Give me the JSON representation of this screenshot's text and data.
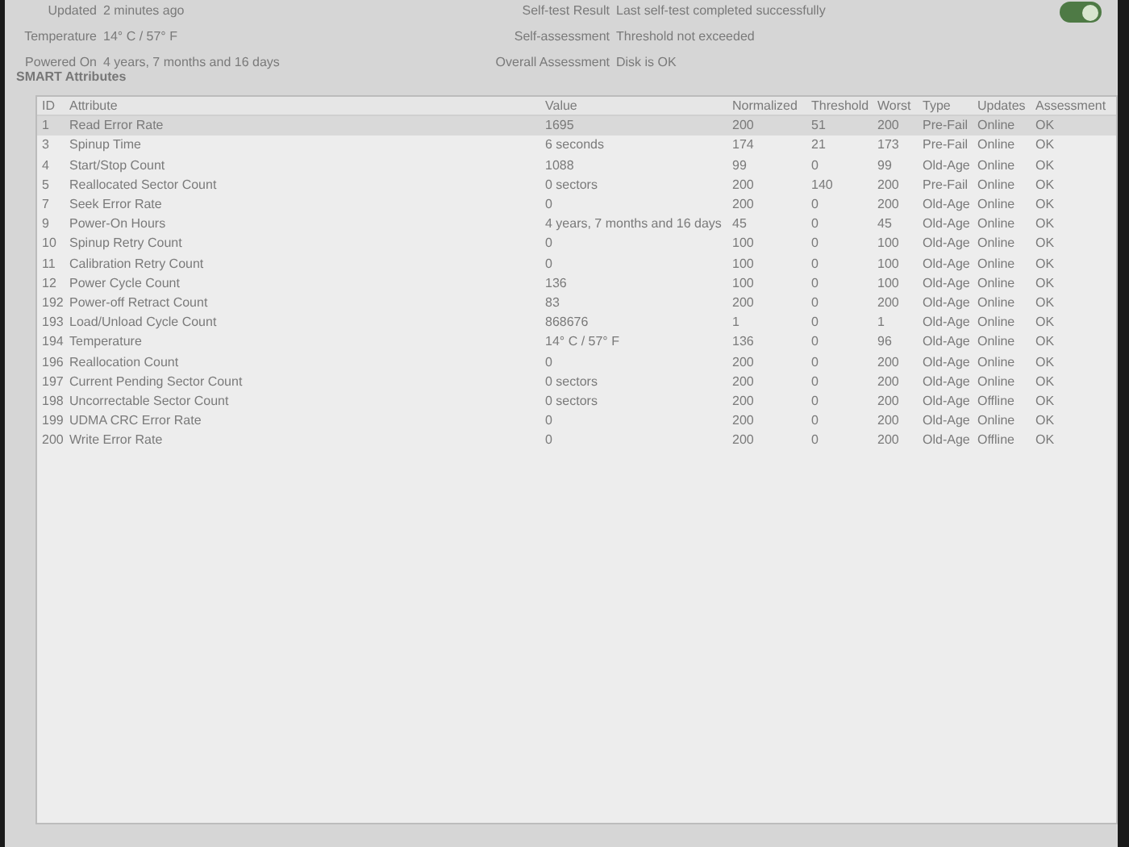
{
  "info_left": [
    {
      "label": "Updated",
      "value": "2 minutes ago"
    },
    {
      "label": "Temperature",
      "value": "14° C / 57° F"
    },
    {
      "label": "Powered On",
      "value": "4 years, 7 months and 16 days"
    }
  ],
  "info_right": [
    {
      "label": "Self-test Result",
      "value": "Last self-test completed successfully"
    },
    {
      "label": "Self-assessment",
      "value": "Threshold not exceeded"
    },
    {
      "label": "Overall Assessment",
      "value": "Disk is OK"
    }
  ],
  "smart_toggle": {
    "on": true
  },
  "section_title": "SMART Attributes",
  "table": {
    "columns": [
      "ID",
      "Attribute",
      "Value",
      "Normalized",
      "Threshold",
      "Worst",
      "Type",
      "Updates",
      "Assessment"
    ],
    "rows": [
      {
        "cells": [
          "1",
          "Read Error Rate",
          "1695",
          "200",
          "51",
          "200",
          "Pre-Fail",
          "Online",
          "OK"
        ],
        "selected": true
      },
      {
        "cells": [
          "3",
          "Spinup Time",
          "6 seconds",
          "174",
          "21",
          "173",
          "Pre-Fail",
          "Online",
          "OK"
        ],
        "selected": false
      },
      {
        "cells": [
          "4",
          "Start/Stop Count",
          "1088",
          "99",
          "0",
          "99",
          "Old-Age",
          "Online",
          "OK"
        ],
        "selected": false
      },
      {
        "cells": [
          "5",
          "Reallocated Sector Count",
          "0 sectors",
          "200",
          "140",
          "200",
          "Pre-Fail",
          "Online",
          "OK"
        ],
        "selected": false
      },
      {
        "cells": [
          "7",
          "Seek Error Rate",
          "0",
          "200",
          "0",
          "200",
          "Old-Age",
          "Online",
          "OK"
        ],
        "selected": false
      },
      {
        "cells": [
          "9",
          "Power-On Hours",
          "4 years, 7 months and 16 days",
          "45",
          "0",
          "45",
          "Old-Age",
          "Online",
          "OK"
        ],
        "selected": false
      },
      {
        "cells": [
          "10",
          "Spinup Retry Count",
          "0",
          "100",
          "0",
          "100",
          "Old-Age",
          "Online",
          "OK"
        ],
        "selected": false
      },
      {
        "cells": [
          "11",
          "Calibration Retry Count",
          "0",
          "100",
          "0",
          "100",
          "Old-Age",
          "Online",
          "OK"
        ],
        "selected": false
      },
      {
        "cells": [
          "12",
          "Power Cycle Count",
          "136",
          "100",
          "0",
          "100",
          "Old-Age",
          "Online",
          "OK"
        ],
        "selected": false
      },
      {
        "cells": [
          "192",
          "Power-off Retract Count",
          "83",
          "200",
          "0",
          "200",
          "Old-Age",
          "Online",
          "OK"
        ],
        "selected": false
      },
      {
        "cells": [
          "193",
          "Load/Unload Cycle Count",
          "868676",
          "1",
          "0",
          "1",
          "Old-Age",
          "Online",
          "OK"
        ],
        "selected": false
      },
      {
        "cells": [
          "194",
          "Temperature",
          "14° C / 57° F",
          "136",
          "0",
          "96",
          "Old-Age",
          "Online",
          "OK"
        ],
        "selected": false
      },
      {
        "cells": [
          "196",
          "Reallocation Count",
          "0",
          "200",
          "0",
          "200",
          "Old-Age",
          "Online",
          "OK"
        ],
        "selected": false
      },
      {
        "cells": [
          "197",
          "Current Pending Sector Count",
          "0 sectors",
          "200",
          "0",
          "200",
          "Old-Age",
          "Online",
          "OK"
        ],
        "selected": false
      },
      {
        "cells": [
          "198",
          "Uncorrectable Sector Count",
          "0 sectors",
          "200",
          "0",
          "200",
          "Old-Age",
          "Offline",
          "OK"
        ],
        "selected": false
      },
      {
        "cells": [
          "199",
          "UDMA CRC Error Rate",
          "0",
          "200",
          "0",
          "200",
          "Old-Age",
          "Online",
          "OK"
        ],
        "selected": false
      },
      {
        "cells": [
          "200",
          "Write Error Rate",
          "0",
          "200",
          "0",
          "200",
          "Old-Age",
          "Offline",
          "OK"
        ],
        "selected": false
      }
    ]
  }
}
